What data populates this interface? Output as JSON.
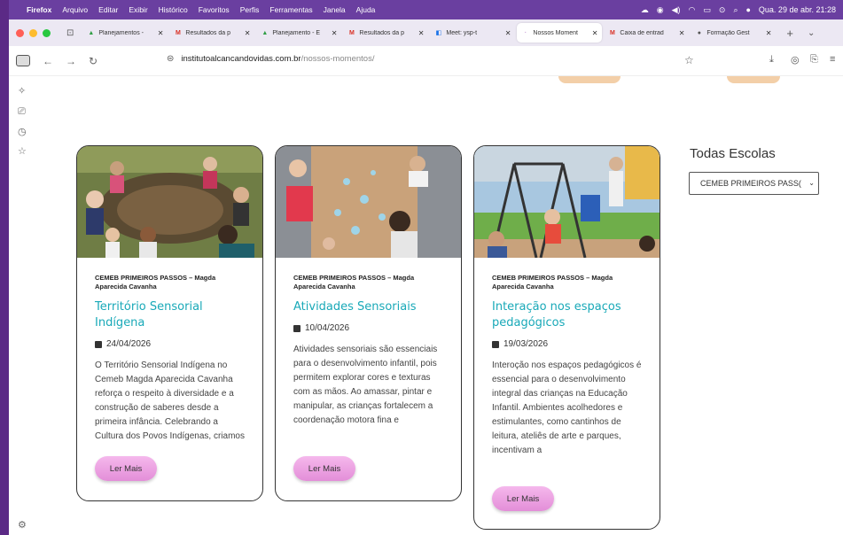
{
  "menubar": {
    "app": "Firefox",
    "items": [
      "Arquivo",
      "Editar",
      "Exibir",
      "Histórico",
      "Favoritos",
      "Perfis",
      "Ferramentas",
      "Janela",
      "Ajuda"
    ],
    "datetime": "Qua. 29 de abr. 21:28"
  },
  "tabs": [
    {
      "label": "Planejamentos -",
      "fav": "▲",
      "color": "#2f9e44"
    },
    {
      "label": "Resultados da p",
      "fav": "M",
      "color": "#d93025"
    },
    {
      "label": "Planejamento - E",
      "fav": "▲",
      "color": "#2f9e44"
    },
    {
      "label": "Resultados da p",
      "fav": "M",
      "color": "#d93025"
    },
    {
      "label": "Meet: ysp-t",
      "fav": "◧",
      "color": "#1a73e8"
    },
    {
      "label": "Nossos Moment",
      "fav": "·",
      "color": "#c8a0d8"
    },
    {
      "label": "Caixa de entrad",
      "fav": "M",
      "color": "#d93025"
    },
    {
      "label": "Formação Gest",
      "fav": "●",
      "color": "#555555"
    }
  ],
  "url": {
    "domain": "institutoalcancandovidas.com.br",
    "path": "/nossos-momentos/"
  },
  "filter": {
    "title": "Todas Escolas",
    "selected": "CEMEB PRIMEIROS PASS("
  },
  "cards": [
    {
      "school": "CEMEB PRIMEIROS PASSOS – Magda Aparecida Cavanha",
      "title": "Território Sensorial Indígena",
      "date": "24/04/2026",
      "excerpt": "O Território Sensorial Indígena no Cemeb Magda Aparecida Cavanha reforça o respeito à diversidade e a construção de saberes desde a primeira infância. Celebrando a Cultura dos Povos Indígenas, criamos",
      "button": "Ler Mais"
    },
    {
      "school": "CEMEB PRIMEIROS PASSOS – Magda Aparecida Cavanha",
      "title": "Atividades Sensoriais",
      "date": "10/04/2026",
      "excerpt": "Atividades sensoriais são essenciais para o desenvolvimento infantil, pois permitem explorar cores e texturas com as mãos. Ao amassar, pintar e manipular, as crianças fortalecem a coordenação motora fina e",
      "button": "Ler Mais"
    },
    {
      "school": "CEMEB PRIMEIROS PASSOS – Magda Aparecida Cavanha",
      "title": "Interação nos espaços pedagógicos",
      "date": "19/03/2026",
      "excerpt": "Interoção nos espaços pedagógicos é essencial para o desenvolvimento integral das crianças na Educação Infantil. Ambientes acolhedores e estimulantes, como cantinhos de leitura, ateliês de arte e parques, incentivam a",
      "button": "Ler Mais"
    }
  ]
}
